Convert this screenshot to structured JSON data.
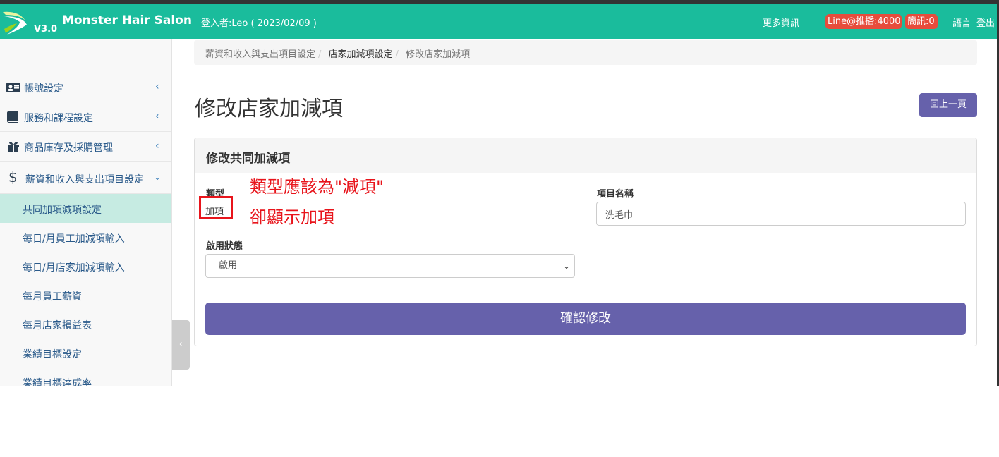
{
  "navbar": {
    "version": "V3.0",
    "brand": "Monster Hair Salon",
    "login_info": "登入者:Leo ( 2023/02/09 )",
    "more_info": "更多資訊",
    "line_badge": "Line@推播:4000",
    "sms_badge": "簡訊:0",
    "language": "語言",
    "logout": "登出"
  },
  "sidebar": {
    "items": [
      {
        "label": "帳號設定",
        "icon": "id-card-icon"
      },
      {
        "label": "服務和課程設定",
        "icon": "book-icon"
      },
      {
        "label": "商品庫存及採購管理",
        "icon": "gift-icon"
      },
      {
        "label": "薪資和收入與支出項目設定",
        "icon": "dollar-icon"
      }
    ],
    "subitems": [
      "共同加項減項設定",
      "每日/月員工加減項輸入",
      "每日/月店家加減項輸入",
      "每月員工薪資",
      "每月店家損益表",
      "業績目標設定",
      "業績目標達成率"
    ]
  },
  "breadcrumb": {
    "items": [
      "薪資和收入與支出項目設定",
      "店家加減項設定",
      "修改店家加減項"
    ]
  },
  "page": {
    "title": "修改店家加減項",
    "back_button": "回上一頁"
  },
  "panel": {
    "title": "修改共同加減項",
    "type_label": "類型",
    "type_value": "加項",
    "name_label": "項目名稱",
    "name_value": "洗毛巾",
    "status_label": "啟用狀態",
    "status_value": "啟用",
    "submit": "確認修改"
  },
  "annotation": {
    "line1": "類型應該為\"減項\"",
    "line2": "卻顯示加項",
    "color": "#e8141b"
  },
  "colors": {
    "navbar": "#1abc9c",
    "primary_button": "#6661ab",
    "badge": "#e74c3c",
    "active_menu": "#c6ebe2"
  }
}
